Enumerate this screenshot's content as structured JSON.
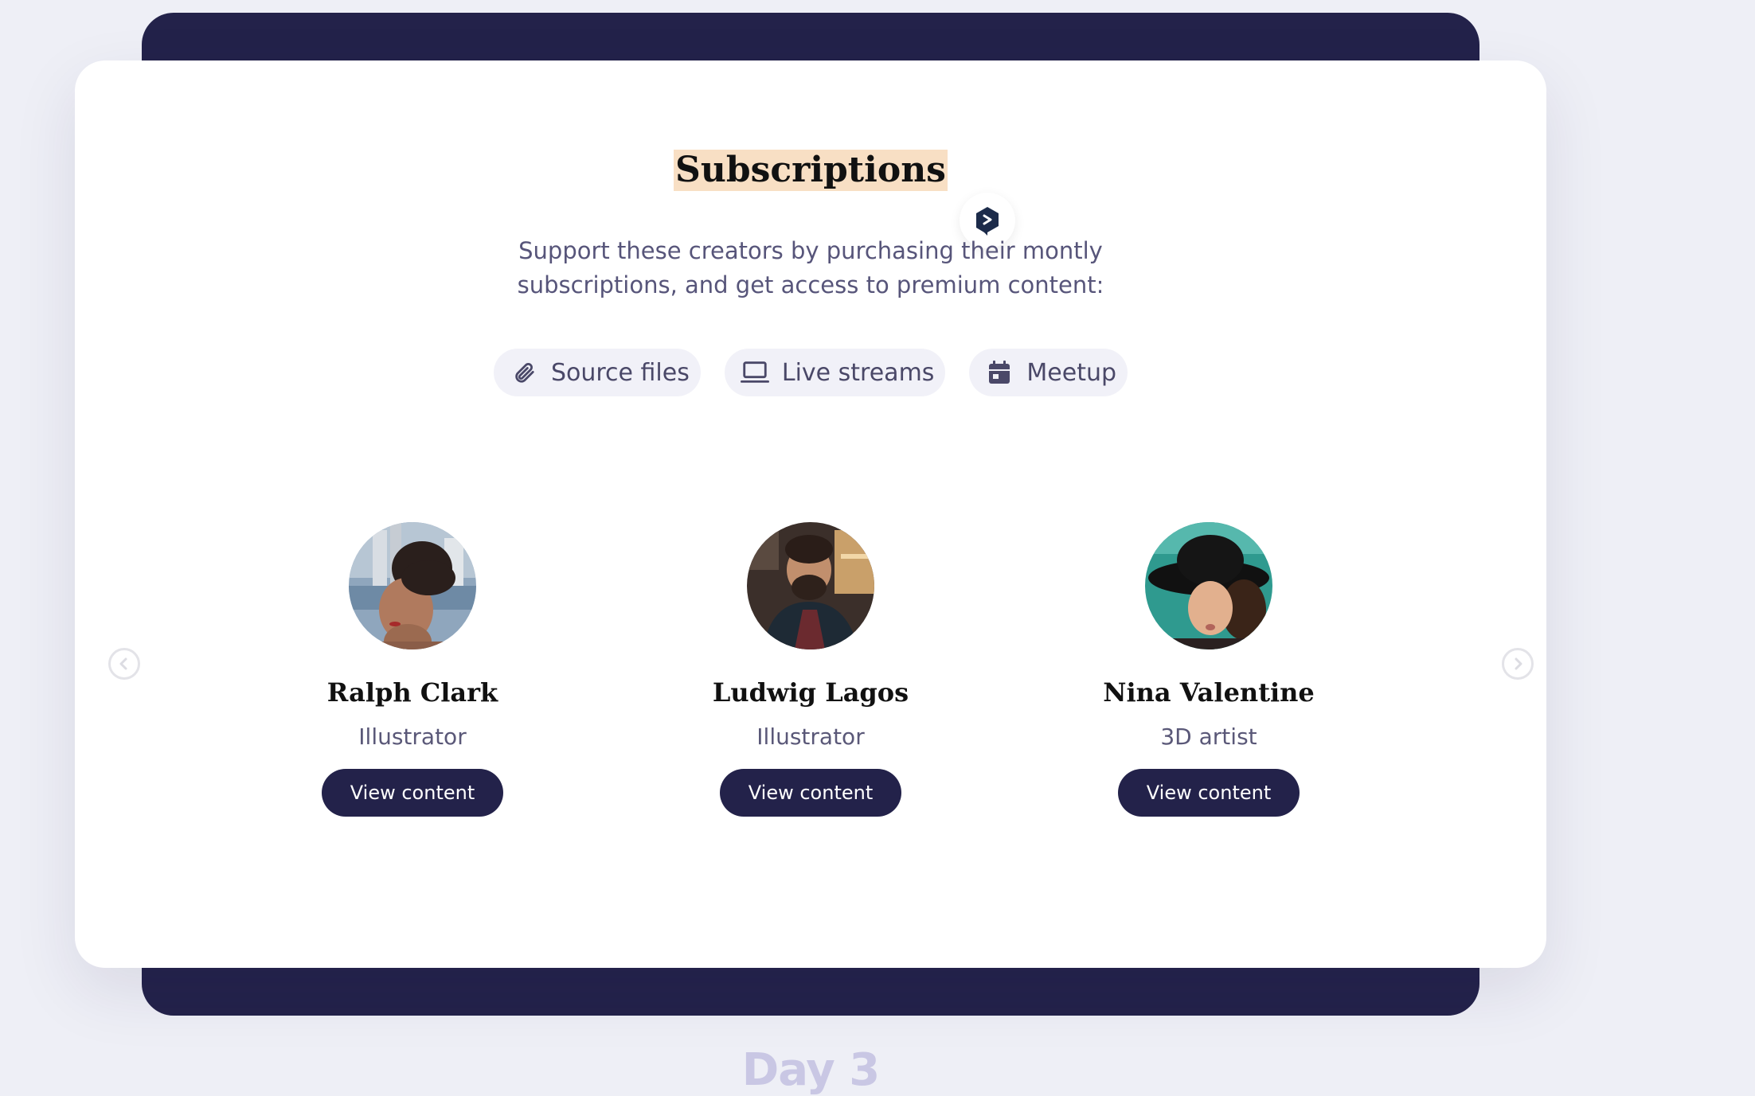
{
  "page": {
    "title": "Subscriptions",
    "subtitle_line1": "Support these creators by purchasing their montly",
    "subtitle_line2": "subscriptions, and get access to premium content:",
    "next_section_heading": "Day 3"
  },
  "chips": [
    {
      "label": "Source files",
      "icon": "paperclip-icon"
    },
    {
      "label": "Live streams",
      "icon": "monitor-icon"
    },
    {
      "label": "Meetup",
      "icon": "calendar-icon"
    }
  ],
  "creators": [
    {
      "name": "Ralph Clark",
      "role": "Illustrator",
      "button": "View content"
    },
    {
      "name": "Ludwig Lagos",
      "role": "Illustrator",
      "button": "View content"
    },
    {
      "name": "Nina Valentine",
      "role": "3D artist",
      "button": "View content"
    }
  ],
  "carousel": {
    "prev_icon": "chevron-left-icon",
    "next_icon": "chevron-right-icon"
  },
  "colors": {
    "page_background": "#eeeff6",
    "navy": "#23224a",
    "card": "#ffffff",
    "title_highlight": "#f8dfc4",
    "chip_background": "#f1f1f8",
    "muted_text": "#57557a"
  }
}
